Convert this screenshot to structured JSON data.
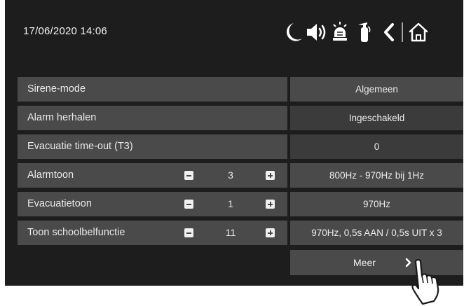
{
  "header": {
    "datetime": "17/06/2020 14:06",
    "icons": [
      "moon-icon",
      "speaker-icon",
      "siren-icon",
      "fire-extinguisher-icon",
      "back-icon",
      "home-icon"
    ]
  },
  "rows": [
    {
      "label": "Sirene-mode",
      "value": "Algemeen"
    },
    {
      "label": "Alarm herhalen",
      "value": "Ingeschakeld"
    },
    {
      "label": "Evacuatie time-out (T3)",
      "value": "0"
    },
    {
      "label": "Alarmtoon",
      "number": "3",
      "value": "800Hz - 970Hz bij 1Hz"
    },
    {
      "label": "Evacuatietoon",
      "number": "1",
      "value": "970Hz"
    },
    {
      "label": "Toon schoolbelfunctie",
      "number": "11",
      "value": "970Hz, 0,5s AAN / 0,5s UIT x 3"
    }
  ],
  "more_button": {
    "label": "Meer"
  },
  "colors": {
    "screen": "#1d1d1d",
    "cell": "#4a4a4a",
    "cell_dark": "#3b3b3b",
    "text": "#eaeaea"
  }
}
